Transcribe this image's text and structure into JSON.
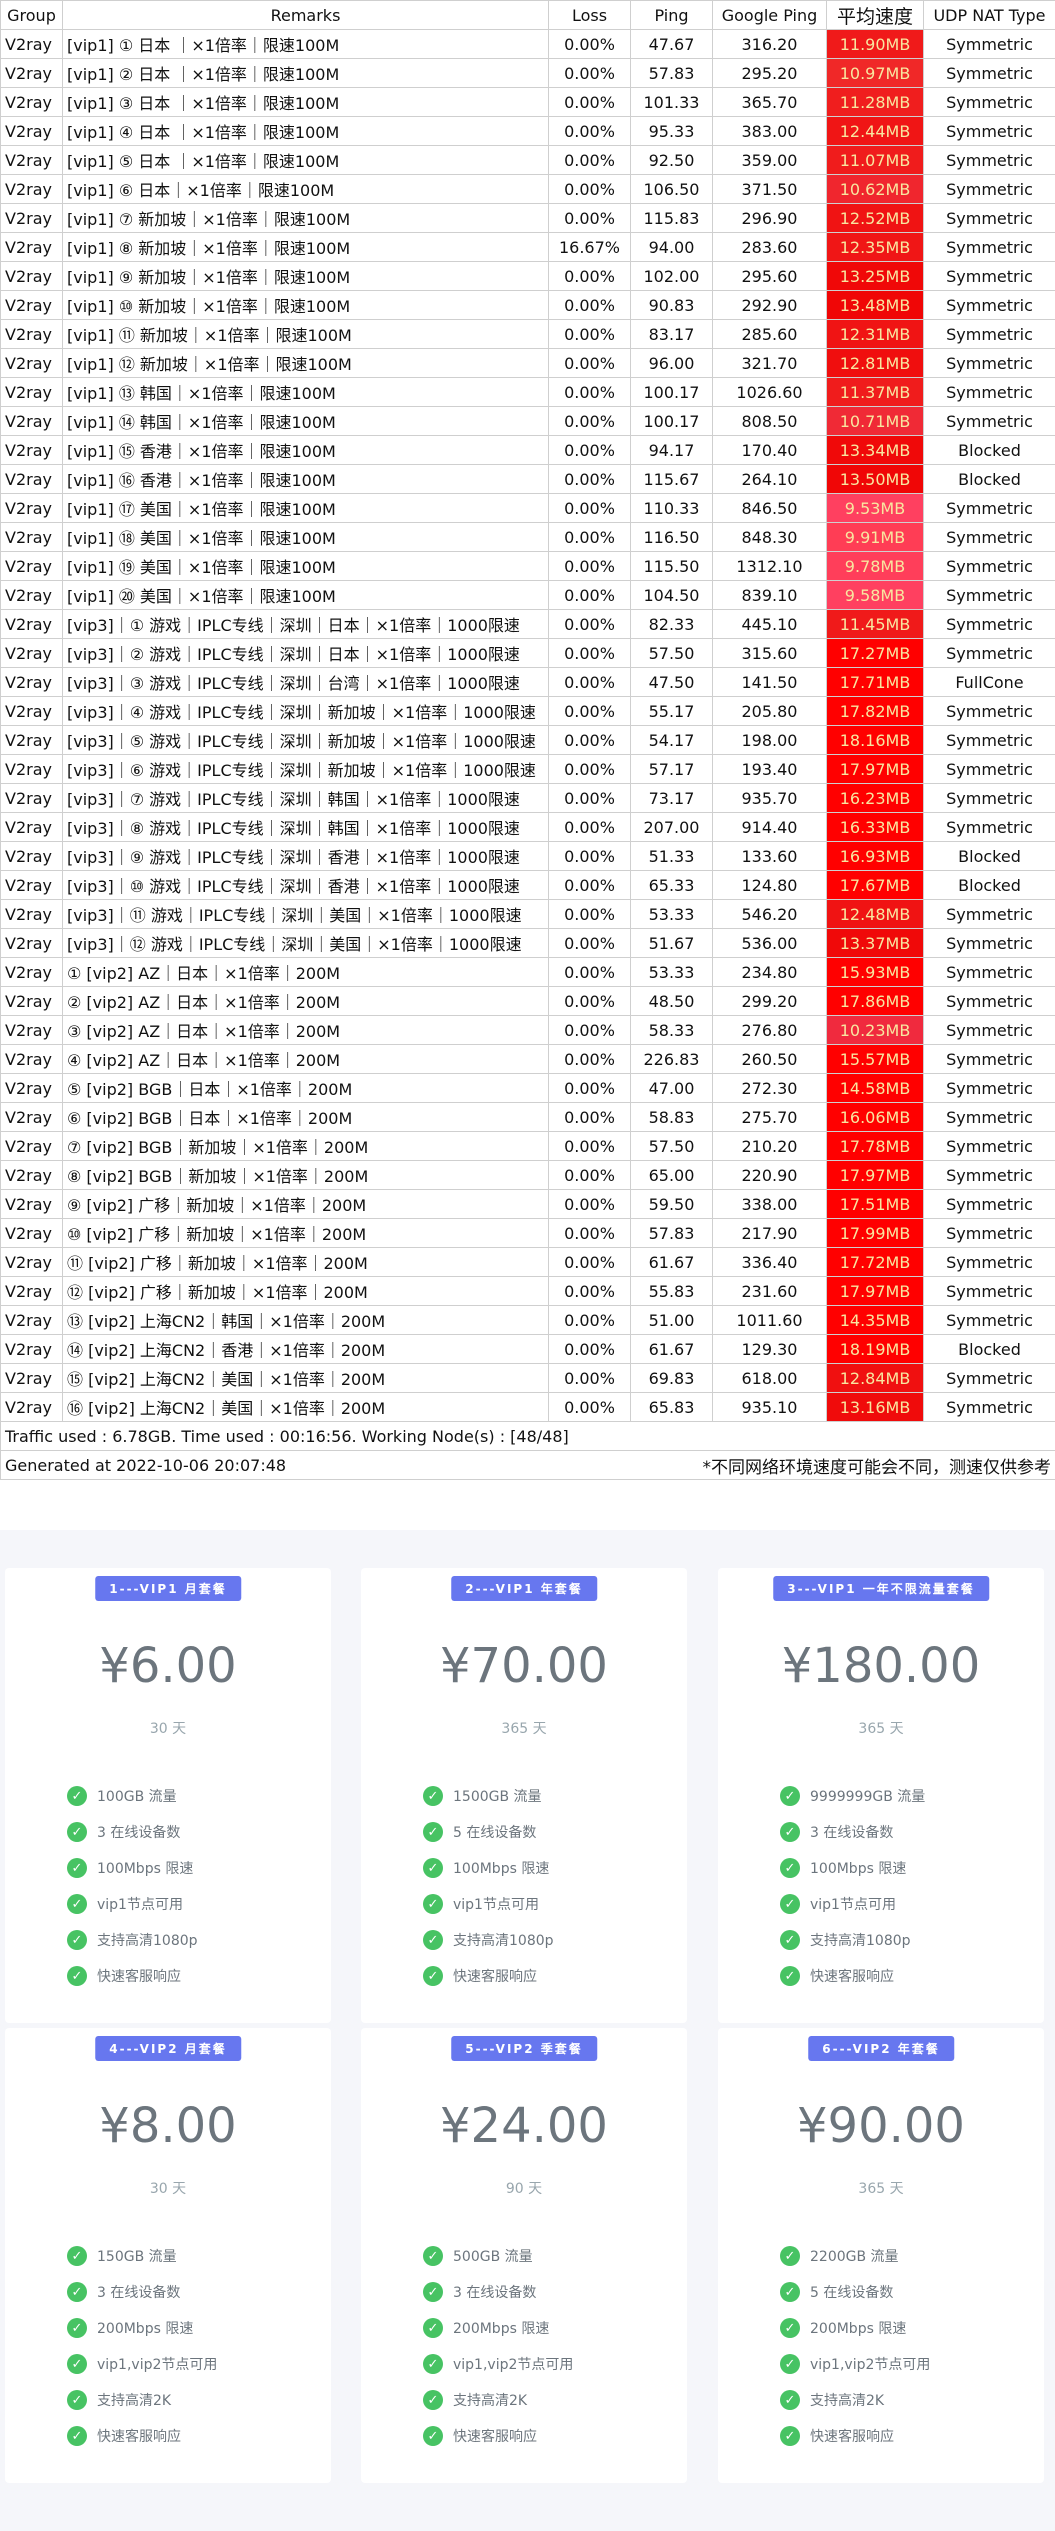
{
  "table": {
    "headers": [
      "Group",
      "Remarks",
      "Loss",
      "Ping",
      "Google Ping",
      "平均速度",
      "UDP NAT Type"
    ],
    "rows": [
      [
        "V2ray",
        "[vip1] ① 日本 ｜×1倍率｜限速100M",
        "0.00%",
        "47.67",
        "316.20",
        "11.90MB",
        "Symmetric"
      ],
      [
        "V2ray",
        "[vip1] ② 日本 ｜×1倍率｜限速100M",
        "0.00%",
        "57.83",
        "295.20",
        "10.97MB",
        "Symmetric"
      ],
      [
        "V2ray",
        "[vip1] ③ 日本 ｜×1倍率｜限速100M",
        "0.00%",
        "101.33",
        "365.70",
        "11.28MB",
        "Symmetric"
      ],
      [
        "V2ray",
        "[vip1] ④ 日本 ｜×1倍率｜限速100M",
        "0.00%",
        "95.33",
        "383.00",
        "12.44MB",
        "Symmetric"
      ],
      [
        "V2ray",
        "[vip1] ⑤ 日本 ｜×1倍率｜限速100M",
        "0.00%",
        "92.50",
        "359.00",
        "11.07MB",
        "Symmetric"
      ],
      [
        "V2ray",
        "[vip1] ⑥ 日本｜×1倍率｜限速100M",
        "0.00%",
        "106.50",
        "371.50",
        "10.62MB",
        "Symmetric"
      ],
      [
        "V2ray",
        "[vip1] ⑦ 新加坡｜×1倍率｜限速100M",
        "0.00%",
        "115.83",
        "296.90",
        "12.52MB",
        "Symmetric"
      ],
      [
        "V2ray",
        "[vip1] ⑧ 新加坡｜×1倍率｜限速100M",
        "16.67%",
        "94.00",
        "283.60",
        "12.35MB",
        "Symmetric"
      ],
      [
        "V2ray",
        "[vip1] ⑨ 新加坡｜×1倍率｜限速100M",
        "0.00%",
        "102.00",
        "295.60",
        "13.25MB",
        "Symmetric"
      ],
      [
        "V2ray",
        "[vip1] ⑩ 新加坡｜×1倍率｜限速100M",
        "0.00%",
        "90.83",
        "292.90",
        "13.48MB",
        "Symmetric"
      ],
      [
        "V2ray",
        "[vip1] ⑪ 新加坡｜×1倍率｜限速100M",
        "0.00%",
        "83.17",
        "285.60",
        "12.31MB",
        "Symmetric"
      ],
      [
        "V2ray",
        "[vip1] ⑫ 新加坡｜×1倍率｜限速100M",
        "0.00%",
        "96.00",
        "321.70",
        "12.81MB",
        "Symmetric"
      ],
      [
        "V2ray",
        "[vip1] ⑬ 韩国｜×1倍率｜限速100M",
        "0.00%",
        "100.17",
        "1026.60",
        "11.37MB",
        "Symmetric"
      ],
      [
        "V2ray",
        "[vip1] ⑭ 韩国｜×1倍率｜限速100M",
        "0.00%",
        "100.17",
        "808.50",
        "10.71MB",
        "Symmetric"
      ],
      [
        "V2ray",
        "[vip1] ⑮ 香港｜×1倍率｜限速100M",
        "0.00%",
        "94.17",
        "170.40",
        "13.34MB",
        "Blocked"
      ],
      [
        "V2ray",
        "[vip1] ⑯ 香港｜×1倍率｜限速100M",
        "0.00%",
        "115.67",
        "264.10",
        "13.50MB",
        "Blocked"
      ],
      [
        "V2ray",
        "[vip1] ⑰ 美国｜×1倍率｜限速100M",
        "0.00%",
        "110.33",
        "846.50",
        "9.53MB",
        "Symmetric"
      ],
      [
        "V2ray",
        "[vip1] ⑱ 美国｜×1倍率｜限速100M",
        "0.00%",
        "116.50",
        "848.30",
        "9.91MB",
        "Symmetric"
      ],
      [
        "V2ray",
        "[vip1] ⑲ 美国｜×1倍率｜限速100M",
        "0.00%",
        "115.50",
        "1312.10",
        "9.78MB",
        "Symmetric"
      ],
      [
        "V2ray",
        "[vip1] ⑳ 美国｜×1倍率｜限速100M",
        "0.00%",
        "104.50",
        "839.10",
        "9.58MB",
        "Symmetric"
      ],
      [
        "V2ray",
        "[vip3]｜① 游戏｜IPLC专线｜深圳｜日本｜×1倍率｜1000限速",
        "0.00%",
        "82.33",
        "445.10",
        "11.45MB",
        "Symmetric"
      ],
      [
        "V2ray",
        "[vip3]｜② 游戏｜IPLC专线｜深圳｜日本｜×1倍率｜1000限速",
        "0.00%",
        "57.50",
        "315.60",
        "17.27MB",
        "Symmetric"
      ],
      [
        "V2ray",
        "[vip3]｜③ 游戏｜IPLC专线｜深圳｜台湾｜×1倍率｜1000限速",
        "0.00%",
        "47.50",
        "141.50",
        "17.71MB",
        "FullCone"
      ],
      [
        "V2ray",
        "[vip3]｜④ 游戏｜IPLC专线｜深圳｜新加坡｜×1倍率｜1000限速",
        "0.00%",
        "55.17",
        "205.80",
        "17.82MB",
        "Symmetric"
      ],
      [
        "V2ray",
        "[vip3]｜⑤ 游戏｜IPLC专线｜深圳｜新加坡｜×1倍率｜1000限速",
        "0.00%",
        "54.17",
        "198.00",
        "18.16MB",
        "Symmetric"
      ],
      [
        "V2ray",
        "[vip3]｜⑥ 游戏｜IPLC专线｜深圳｜新加坡｜×1倍率｜1000限速",
        "0.00%",
        "57.17",
        "193.40",
        "17.97MB",
        "Symmetric"
      ],
      [
        "V2ray",
        "[vip3]｜⑦ 游戏｜IPLC专线｜深圳｜韩国｜×1倍率｜1000限速",
        "0.00%",
        "73.17",
        "935.70",
        "16.23MB",
        "Symmetric"
      ],
      [
        "V2ray",
        "[vip3]｜⑧ 游戏｜IPLC专线｜深圳｜韩国｜×1倍率｜1000限速",
        "0.00%",
        "207.00",
        "914.40",
        "16.33MB",
        "Symmetric"
      ],
      [
        "V2ray",
        "[vip3]｜⑨ 游戏｜IPLC专线｜深圳｜香港｜×1倍率｜1000限速",
        "0.00%",
        "51.33",
        "133.60",
        "16.93MB",
        "Blocked"
      ],
      [
        "V2ray",
        "[vip3]｜⑩ 游戏｜IPLC专线｜深圳｜香港｜×1倍率｜1000限速",
        "0.00%",
        "65.33",
        "124.80",
        "17.67MB",
        "Blocked"
      ],
      [
        "V2ray",
        "[vip3]｜⑪ 游戏｜IPLC专线｜深圳｜美国｜×1倍率｜1000限速",
        "0.00%",
        "53.33",
        "546.20",
        "12.48MB",
        "Symmetric"
      ],
      [
        "V2ray",
        "[vip3]｜⑫ 游戏｜IPLC专线｜深圳｜美国｜×1倍率｜1000限速",
        "0.00%",
        "51.67",
        "536.00",
        "13.37MB",
        "Symmetric"
      ],
      [
        "V2ray",
        "① [vip2] AZ｜日本｜×1倍率｜200M",
        "0.00%",
        "53.33",
        "234.80",
        "15.93MB",
        "Symmetric"
      ],
      [
        "V2ray",
        "② [vip2] AZ｜日本｜×1倍率｜200M",
        "0.00%",
        "48.50",
        "299.20",
        "17.86MB",
        "Symmetric"
      ],
      [
        "V2ray",
        "③ [vip2] AZ｜日本｜×1倍率｜200M",
        "0.00%",
        "58.33",
        "276.80",
        "10.23MB",
        "Symmetric"
      ],
      [
        "V2ray",
        "④ [vip2] AZ｜日本｜×1倍率｜200M",
        "0.00%",
        "226.83",
        "260.50",
        "15.57MB",
        "Symmetric"
      ],
      [
        "V2ray",
        "⑤ [vip2] BGB｜日本｜×1倍率｜200M",
        "0.00%",
        "47.00",
        "272.30",
        "14.58MB",
        "Symmetric"
      ],
      [
        "V2ray",
        "⑥ [vip2] BGB｜日本｜×1倍率｜200M",
        "0.00%",
        "58.83",
        "275.70",
        "16.06MB",
        "Symmetric"
      ],
      [
        "V2ray",
        "⑦ [vip2] BGB｜新加坡｜×1倍率｜200M",
        "0.00%",
        "57.50",
        "210.20",
        "17.78MB",
        "Symmetric"
      ],
      [
        "V2ray",
        "⑧ [vip2] BGB｜新加坡｜×1倍率｜200M",
        "0.00%",
        "65.00",
        "220.90",
        "17.97MB",
        "Symmetric"
      ],
      [
        "V2ray",
        "⑨ [vip2] 广移｜新加坡｜×1倍率｜200M",
        "0.00%",
        "59.50",
        "338.00",
        "17.51MB",
        "Symmetric"
      ],
      [
        "V2ray",
        "⑩ [vip2] 广移｜新加坡｜×1倍率｜200M",
        "0.00%",
        "57.83",
        "217.90",
        "17.99MB",
        "Symmetric"
      ],
      [
        "V2ray",
        "⑪ [vip2] 广移｜新加坡｜×1倍率｜200M",
        "0.00%",
        "61.67",
        "336.40",
        "17.72MB",
        "Symmetric"
      ],
      [
        "V2ray",
        "⑫ [vip2] 广移｜新加坡｜×1倍率｜200M",
        "0.00%",
        "55.83",
        "231.60",
        "17.97MB",
        "Symmetric"
      ],
      [
        "V2ray",
        "⑬ [vip2] 上海CN2｜韩国｜×1倍率｜200M",
        "0.00%",
        "51.00",
        "1011.60",
        "14.35MB",
        "Symmetric"
      ],
      [
        "V2ray",
        "⑭ [vip2] 上海CN2｜香港｜×1倍率｜200M",
        "0.00%",
        "61.67",
        "129.30",
        "18.19MB",
        "Blocked"
      ],
      [
        "V2ray",
        "⑮ [vip2] 上海CN2｜美国｜×1倍率｜200M",
        "0.00%",
        "69.83",
        "618.00",
        "12.84MB",
        "Symmetric"
      ],
      [
        "V2ray",
        "⑯ [vip2] 上海CN2｜美国｜×1倍率｜200M",
        "0.00%",
        "65.83",
        "935.10",
        "13.16MB",
        "Symmetric"
      ]
    ],
    "speed_colors": [
      "#f01a1a",
      "#f02828",
      "#f01e1e",
      "#f01515",
      "#f01c1c",
      "#f0262e",
      "#f01313",
      "#f01616",
      "#f00808",
      "#f00606",
      "#f01414",
      "#f00e0e",
      "#f01c1c",
      "#f02a36",
      "#f00909",
      "#f00606",
      "#ff4060",
      "#ff3d55",
      "#ff3e5a",
      "#ff4060",
      "#f01a1a",
      "#ff0000",
      "#ff0000",
      "#ff0000",
      "#ff0000",
      "#ff0000",
      "#ff0000",
      "#ff0000",
      "#ff0000",
      "#ff0000",
      "#f01313",
      "#f00909",
      "#ff0000",
      "#ff0000",
      "#f02a3e",
      "#ff0000",
      "#ff0000",
      "#ff0000",
      "#ff0000",
      "#ff0000",
      "#ff0000",
      "#ff0000",
      "#ff0000",
      "#ff0000",
      "#ff0000",
      "#ff0000",
      "#f01010",
      "#f00b0b"
    ],
    "footer_traffic": "Traffic used : 6.78GB. Time used : 00:16:56. Working Node(s) : [48/48]",
    "footer_generated": "Generated at 2022-10-06 20:07:48",
    "footer_note": "*不同网络环境速度可能会不同，测速仅供参考"
  },
  "plans": [
    {
      "badge": "1---VIP1 月套餐",
      "price": "¥6.00",
      "period": "30 天",
      "features": [
        "100GB 流量",
        "3 在线设备数",
        "100Mbps 限速",
        "vip1节点可用",
        "支持高清1080p",
        "快速客服响应"
      ]
    },
    {
      "badge": "2---VIP1 年套餐",
      "price": "¥70.00",
      "period": "365 天",
      "features": [
        "1500GB 流量",
        "5 在线设备数",
        "100Mbps 限速",
        "vip1节点可用",
        "支持高清1080p",
        "快速客服响应"
      ]
    },
    {
      "badge": "3---VIP1 一年不限流量套餐",
      "price": "¥180.00",
      "period": "365 天",
      "features": [
        "9999999GB 流量",
        "3 在线设备数",
        "100Mbps 限速",
        "vip1节点可用",
        "支持高清1080p",
        "快速客服响应"
      ]
    },
    {
      "badge": "4---VIP2 月套餐",
      "price": "¥8.00",
      "period": "30 天",
      "features": [
        "150GB 流量",
        "3 在线设备数",
        "200Mbps 限速",
        "vip1,vip2节点可用",
        "支持高清2K",
        "快速客服响应"
      ]
    },
    {
      "badge": "5---VIP2 季套餐",
      "price": "¥24.00",
      "period": "90 天",
      "features": [
        "500GB 流量",
        "3 在线设备数",
        "200Mbps 限速",
        "vip1,vip2节点可用",
        "支持高清2K",
        "快速客服响应"
      ]
    },
    {
      "badge": "6---VIP2 年套餐",
      "price": "¥90.00",
      "period": "365 天",
      "features": [
        "2200GB 流量",
        "5 在线设备数",
        "200Mbps 限速",
        "vip1,vip2节点可用",
        "支持高清2K",
        "快速客服响应"
      ]
    }
  ],
  "colors": {
    "accent": "#6777ef",
    "check": "#47c363"
  },
  "icons": {
    "feature": "check-circle-icon"
  }
}
